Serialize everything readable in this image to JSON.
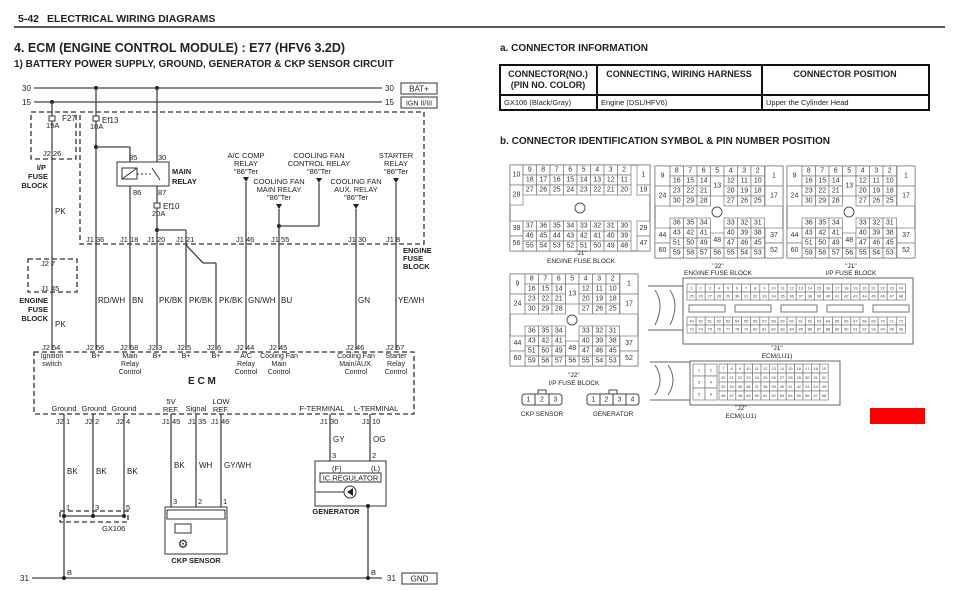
{
  "header": {
    "page": "5-42",
    "section": "ELECTRICAL WIRING DIAGRAMS"
  },
  "title": "4. ECM (ENGINE CONTROL MODULE) : E77 (HFV6 3.2D)",
  "subtitle": "1) BATTERY POWER SUPPLY, GROUND, GENERATOR & CKP SENSOR CIRCUIT",
  "rails": {
    "bat": {
      "num": "30",
      "label": "BAT+"
    },
    "ign": {
      "num": "15",
      "label": "IGN II/III"
    },
    "gnd": {
      "num": "31",
      "label": "GND"
    }
  },
  "fuses": {
    "f27": {
      "name": "F27",
      "rating": "15A"
    },
    "ef13": {
      "name": "Ef13",
      "rating": "10A"
    },
    "ef10": {
      "name": "Ef10",
      "rating": "20A"
    }
  },
  "main_relay": {
    "label1": "MAIN",
    "label2": "RELAY",
    "pin85": "85",
    "pin30": "30",
    "pin86": "86",
    "pin87": "87"
  },
  "ip_fuse_block": {
    "l1": "I/P",
    "l2": "FUSE",
    "l3": "BLOCK",
    "pin": "J2 26"
  },
  "engine_fuse_block_left": {
    "l1": "ENGINE",
    "l2": "FUSE",
    "l3": "BLOCK",
    "pin_top": "J2 7",
    "pin_bottom": "J1 45"
  },
  "engine_fuse_block_right": {
    "l1": "ENGINE",
    "l2": "FUSE",
    "l3": "BLOCK"
  },
  "efb_pins": [
    "J1 36",
    "J1 18",
    "J1 20",
    "J1 21",
    "J1 46",
    "J1 55",
    "J1 30",
    "J1 8"
  ],
  "relays": [
    {
      "l1": "A/C COMP",
      "l2": "RELAY",
      "l3": "\"86\"Ter"
    },
    {
      "l1": "COOLING FAN",
      "l2": "MAIN RELAY",
      "l3": "\"86\"Ter"
    },
    {
      "l1": "COOLING FAN",
      "l2": "CONTROL RELAY",
      "l3": "\"86\"Ter"
    },
    {
      "l1": "COOLING FAN",
      "l2": "AUX. RELAY",
      "l3": "\"86\"Ter"
    },
    {
      "l1": "STARTER",
      "l2": "RELAY",
      "l3": "\"86\"Ter"
    }
  ],
  "upper_wires": [
    "PK",
    "PK",
    "RD/WH",
    "BN",
    "PK/BK",
    "PK/BK",
    "PK/BK",
    "GN/WH",
    "BU",
    "GN",
    "YE/WH"
  ],
  "ecm": {
    "label": "E C M",
    "top_pins": [
      {
        "pin": "J2 54",
        "desc": [
          "Ignition",
          "switch"
        ]
      },
      {
        "pin": "J2 56",
        "desc": [
          "B+"
        ]
      },
      {
        "pin": "J2 58",
        "desc": [
          "Main",
          "Relay",
          "Control"
        ]
      },
      {
        "pin": "J2 3",
        "desc": [
          "B+"
        ]
      },
      {
        "pin": "J2 5",
        "desc": [
          "B+"
        ]
      },
      {
        "pin": "J2 6",
        "desc": [
          "B+"
        ]
      },
      {
        "pin": "J2 44",
        "desc": [
          "A/C",
          "Relay",
          "Control"
        ]
      },
      {
        "pin": "J2 45",
        "desc": [
          "Cooling Fan",
          "Main",
          "Control"
        ]
      },
      {
        "pin": "J2 46",
        "desc": [
          "Cooling Fan",
          "Main/AUX.",
          "Control"
        ]
      },
      {
        "pin": "J2 57",
        "desc": [
          "Starter",
          "Relay",
          "Control"
        ]
      }
    ],
    "bottom_pins": [
      {
        "pin": "J2 1",
        "desc": [
          "Ground"
        ]
      },
      {
        "pin": "J2 2",
        "desc": [
          "Ground"
        ]
      },
      {
        "pin": "J2 4",
        "desc": [
          "Ground"
        ]
      },
      {
        "pin": "J1 45",
        "desc": [
          "5V",
          "REF."
        ]
      },
      {
        "pin": "J1 35",
        "desc": [
          "Signal"
        ]
      },
      {
        "pin": "J1 46",
        "desc": [
          "LOW",
          "REF."
        ]
      },
      {
        "pin": "J1 30",
        "desc": [
          "F-TERMINAL"
        ]
      },
      {
        "pin": "J1 10",
        "desc": [
          "L-TERMINAL"
        ]
      }
    ]
  },
  "lower_wires": [
    "BK",
    "BK",
    "BK",
    "BK",
    "WH",
    "GY/WH",
    "GY",
    "OG"
  ],
  "gx106": {
    "label": "GX106",
    "pins": [
      "1",
      "3",
      "5"
    ]
  },
  "ckp": {
    "label": "CKP SENSOR",
    "pins": [
      "3",
      "2",
      "1"
    ]
  },
  "generator": {
    "label": "GENERATOR",
    "regulator": "IC.REGULATOR",
    "pin_f": "3",
    "pin_l": "2",
    "term_f": "(F)",
    "term_l": "(L)"
  },
  "ground_node": "B",
  "connector_info": {
    "heading": "a. CONNECTOR INFORMATION",
    "columns": [
      "CONNECTOR(NO.)\n(PIN NO. COLOR)",
      "CONNECTING, WIRING HARNESS",
      "CONNECTOR POSITION"
    ],
    "col1_l1": "CONNECTOR(NO.)",
    "col1_l2": "(PIN NO. COLOR)",
    "rows": [
      [
        "GX106 (Black/Gray)",
        "Engine (DSL/HFV6)",
        "Upper the Cylinder Head"
      ]
    ]
  },
  "connector_id": {
    "heading": "b. CONNECTOR IDENTIFICATION SYMBOL & PIN NUMBER POSITION",
    "blocks": [
      {
        "code": "\"J1\"",
        "name": "ENGINE FUSE BLOCK"
      },
      {
        "code": "\"J2\"",
        "name": "ENGINE FUSE BLOCK"
      },
      {
        "code": "\"J1\"",
        "name": "I/P FUSE BLOCK"
      },
      {
        "code": "\"J2\"",
        "name": "I/P FUSE BLOCK"
      },
      {
        "code": "\"J1\"",
        "name": "ECM(LU1)"
      },
      {
        "code": "\"J2\"",
        "name": "ECM(LU1)"
      }
    ],
    "ckp_label": "CKP SENSOR",
    "ckp_pins": [
      "1",
      "2",
      "3"
    ],
    "gen_label": "GENERATOR",
    "gen_pins": [
      "1",
      "2",
      "3",
      "4"
    ]
  },
  "accent": {
    "red_marker": "#ff0000"
  }
}
